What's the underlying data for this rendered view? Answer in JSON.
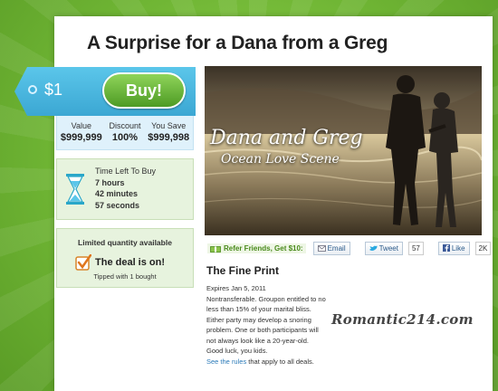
{
  "deal": {
    "title": "A Surprise for a Dana from a Greg",
    "price": "$1",
    "buy_label": "Buy!",
    "stats": [
      {
        "label": "Value",
        "value": "$999,999"
      },
      {
        "label": "Discount",
        "value": "100%"
      },
      {
        "label": "You Save",
        "value": "$999,998"
      }
    ]
  },
  "timer": {
    "heading": "Time Left To Buy",
    "hours": "7 hours",
    "minutes": "42 minutes",
    "seconds": "57 seconds"
  },
  "availability": {
    "heading": "Limited quantity available",
    "status": "The deal is on!",
    "tipped": "Tipped with 1 bought"
  },
  "photo": {
    "overlay_title": "Dana and Greg",
    "overlay_subtitle": "Ocean Love Scene"
  },
  "share": {
    "refer_label": "Refer Friends, Get $10:",
    "email_label": "Email",
    "tweet_label": "Tweet",
    "tweet_count": "57",
    "like_label": "Like",
    "like_count": "2K"
  },
  "fine_print": {
    "heading": "The Fine Print",
    "lines": [
      "Expires Jan 5, 2011",
      "Nontransferable. Groupon entitled to no",
      "less than 15% of your marital bliss.",
      "Either party may develop a snoring",
      "problem. One or both participants will",
      "not always look like a 20-year-old.",
      "Good luck, you kids."
    ],
    "rules_link": "See the rules",
    "rules_suffix": " that apply to all deals."
  },
  "watermark": "Romantic214.com",
  "colors": {
    "background": "#6fb534",
    "tag": "#3ba7d3",
    "buy_button": "#4e9b24",
    "value_box": "#dff1fb",
    "info_box": "#e7f3de",
    "link": "#2a7ab8"
  }
}
